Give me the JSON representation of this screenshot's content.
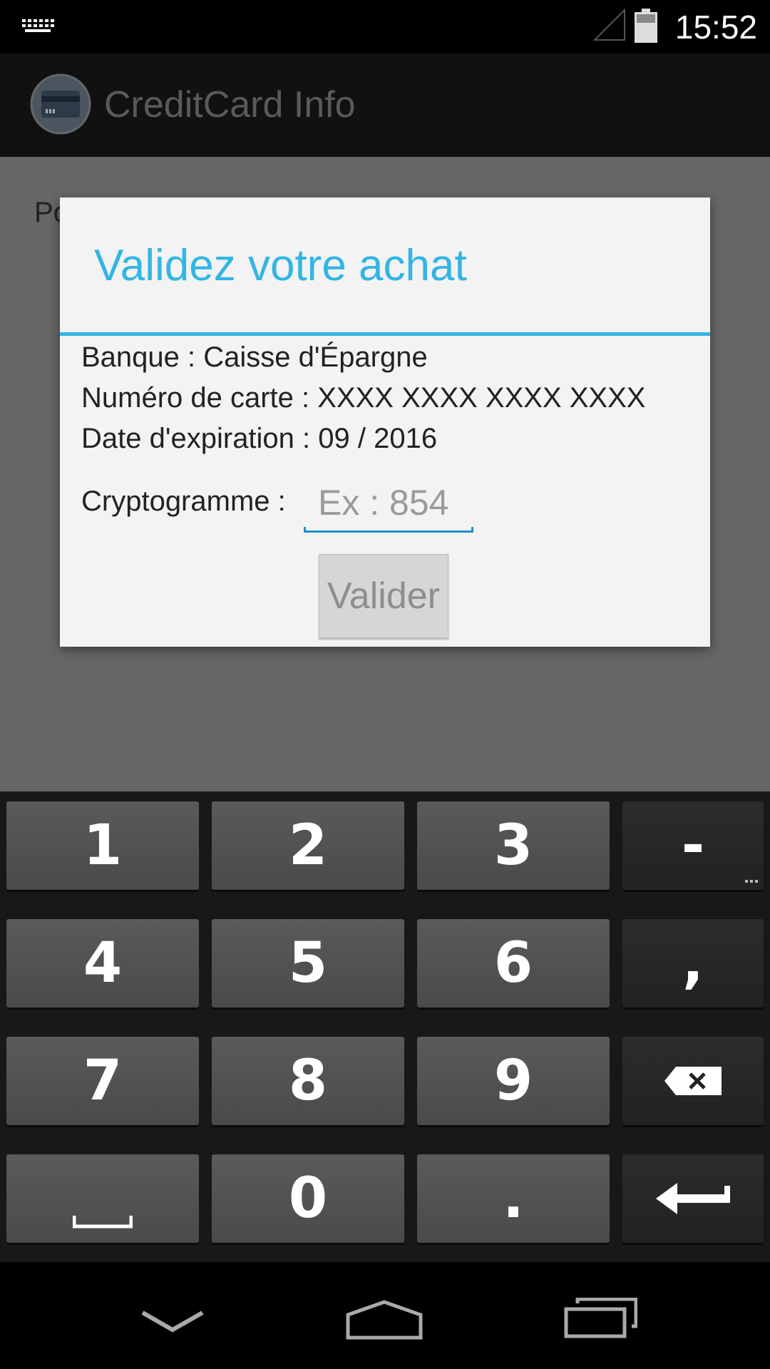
{
  "status_bar": {
    "time": "15:52",
    "icons": [
      "keyboard-icon",
      "signal-icon",
      "battery-icon"
    ]
  },
  "app_bar": {
    "title": "CreditCard Info",
    "icon": "credit-card-icon"
  },
  "background": {
    "text_partial": "Po"
  },
  "dialog": {
    "title": "Validez votre achat",
    "bank_line": "Banque : Caisse d'Épargne",
    "card_line": "Numéro de carte : XXXX XXXX XXXX XXXX",
    "expiry_line": "Date d'expiration : 09 / 2016",
    "crypto_label": "Cryptogramme :",
    "crypto_value": "",
    "crypto_placeholder": "Ex : 854",
    "validate_label": "Valider"
  },
  "keyboard": {
    "row1": [
      "1",
      "2",
      "3",
      "-"
    ],
    "row2": [
      "4",
      "5",
      "6",
      ","
    ],
    "row3": [
      "7",
      "8",
      "9",
      "backspace"
    ],
    "row4": [
      "space",
      "0",
      ".",
      "enter"
    ]
  },
  "nav_bar": {
    "icons": [
      "back-icon",
      "home-icon",
      "recents-icon"
    ]
  },
  "colors": {
    "accent": "#33b5e5",
    "dialog_bg": "#f3f3f3",
    "key_bg": "#505050",
    "key_dark_bg": "#262626"
  }
}
